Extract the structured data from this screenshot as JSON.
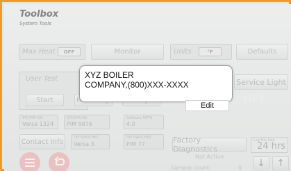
{
  "header": {
    "title": "Toolbox",
    "subtitle": "System Tools"
  },
  "top_row": {
    "max_heat_label": "Max Heat",
    "max_heat_toggle": "OFF",
    "monitor": "Monitor",
    "units_label": "Units",
    "units_toggle": "°F",
    "defaults": "Defaults"
  },
  "user_test": {
    "label": "User Test",
    "start": "Start",
    "hold_step_partial": "Hold Step",
    "step_partial": "Step"
  },
  "service_light": {
    "label": "Service Light",
    "state": "OFF"
  },
  "info": {
    "stc_sw_label": "STC/PIM SW",
    "stc_sw_value": "Versa   1324",
    "pim_sw_label": "STC/PIM SW",
    "pim_sw_value": "PIM   9876",
    "software_label": "Software  MPTS",
    "software_value": "4.0",
    "dip1_label": "DIP SWITCHES",
    "dip1_value": "Versa      3",
    "dip2_label": "DIP SWITCHES",
    "dip2_value": "PIM      77"
  },
  "contact_info": "Contact Info",
  "factory": {
    "label": "Factory Diagnostics",
    "status": "Not Active",
    "sample_label": "Sample count:",
    "sample_value": "0"
  },
  "log_file": {
    "label": "Log File Size",
    "value": "24 hrs"
  },
  "arrows": {
    "down": "↓",
    "up": "↑"
  },
  "popup": {
    "line1": "XYZ BOILER",
    "line2": "COMPANY,(800)XXX-XXXX",
    "edit": "Edit"
  },
  "colors": {
    "frame": "#f29a28",
    "circle": "#f1a3a3"
  }
}
